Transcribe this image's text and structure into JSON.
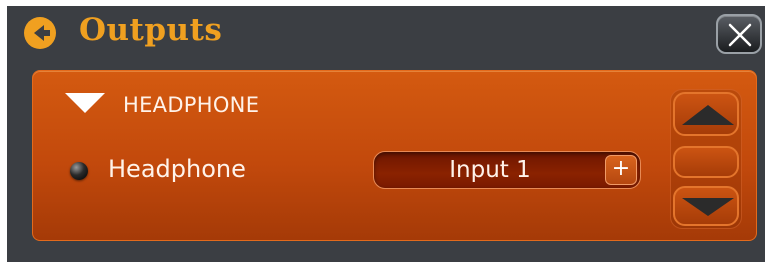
{
  "window": {
    "title": "Outputs"
  },
  "panel": {
    "group_label": "HEADPHONE",
    "output": {
      "label": "Headphone",
      "input_value": "Input 1",
      "plus_label": "+"
    }
  },
  "icons": {
    "back": "back-arrow-icon",
    "close": "close-x-icon",
    "toggle": "triangle-down-icon",
    "scroll_up": "triangle-up-icon",
    "scroll_down": "triangle-down-icon"
  },
  "colors": {
    "title": "#f0a020",
    "panel": "#c2490c",
    "background": "#3b3e43"
  }
}
